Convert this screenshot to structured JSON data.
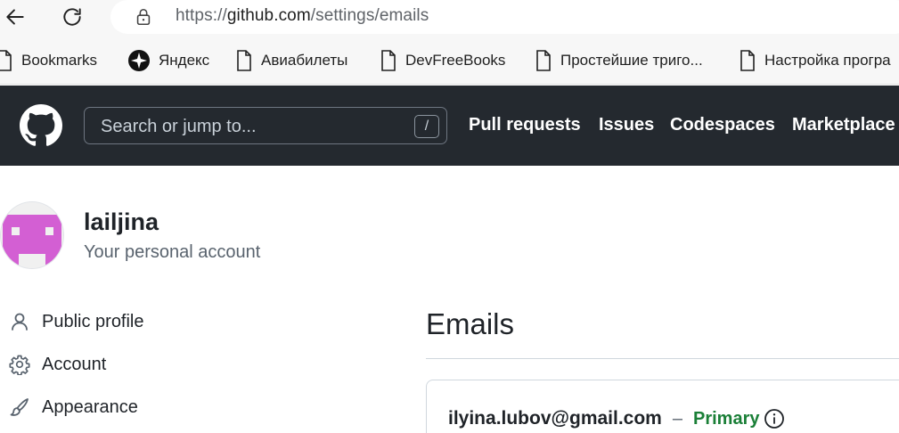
{
  "browser": {
    "url_scheme": "https://",
    "url_host": "github.com",
    "url_path": "/settings/emails",
    "bookmarks": [
      {
        "label": "Bookmarks",
        "icon": "page-icon"
      },
      {
        "label": "Яндекс",
        "icon": "yandex-icon"
      },
      {
        "label": "Авиабилеты",
        "icon": "page-icon"
      },
      {
        "label": "DevFreeBooks",
        "icon": "page-icon"
      },
      {
        "label": "Простейшие триго...",
        "icon": "page-icon"
      },
      {
        "label": "Настройка програ",
        "icon": "page-icon"
      }
    ]
  },
  "header": {
    "search_placeholder": "Search or jump to...",
    "search_shortcut": "/",
    "nav": [
      "Pull requests",
      "Issues",
      "Codespaces",
      "Marketplace"
    ]
  },
  "account": {
    "username": "lailjina",
    "subtitle": "Your personal account",
    "avatar_color": "#d35fd3"
  },
  "sidebar": {
    "items": [
      {
        "label": "Public profile",
        "icon": "person-icon"
      },
      {
        "label": "Account",
        "icon": "gear-icon"
      },
      {
        "label": "Appearance",
        "icon": "paintbrush-icon"
      }
    ]
  },
  "main": {
    "title": "Emails",
    "emails": [
      {
        "address": "ilyina.lubov@gmail.com",
        "separator": "–",
        "badge": "Primary",
        "badge_color": "#1a7f37"
      }
    ]
  }
}
